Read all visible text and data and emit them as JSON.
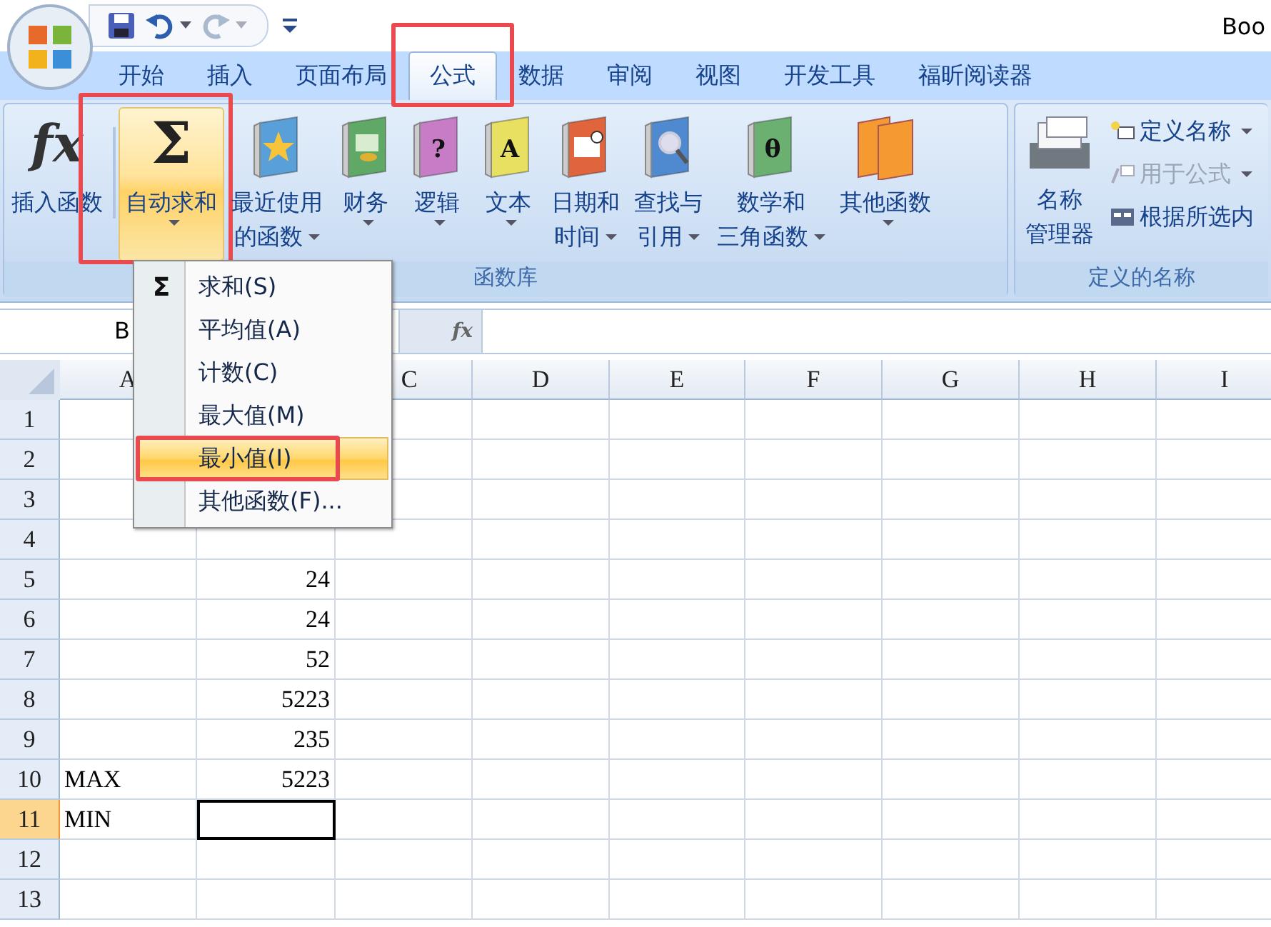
{
  "window": {
    "title": "Boo"
  },
  "tabs": [
    {
      "label": "开始",
      "selected": false,
      "annotated": false
    },
    {
      "label": "插入",
      "selected": false,
      "annotated": false
    },
    {
      "label": "页面布局",
      "selected": false,
      "annotated": false
    },
    {
      "label": "公式",
      "selected": true,
      "annotated": true
    },
    {
      "label": "数据",
      "selected": false,
      "annotated": false
    },
    {
      "label": "审阅",
      "selected": false,
      "annotated": false
    },
    {
      "label": "视图",
      "selected": false,
      "annotated": false
    },
    {
      "label": "开发工具",
      "selected": false,
      "annotated": false
    },
    {
      "label": "福昕阅读器",
      "selected": false,
      "annotated": false
    }
  ],
  "function_library": {
    "title": "函数库",
    "buttons": [
      {
        "kind": "fx",
        "glyph": "fx",
        "lines": [
          "插入函数"
        ],
        "dropdown": false,
        "pressed": false,
        "annotated": false
      },
      {
        "kind": "sigma",
        "glyph": "Σ",
        "lines": [
          "自动求和"
        ],
        "dropdown": true,
        "pressed": true,
        "annotated": true
      },
      {
        "kind": "star",
        "color": "#5aa0d8",
        "lines": [
          "最近使用",
          "的函数"
        ],
        "dropdown": true,
        "pressed": false,
        "annotated": false
      },
      {
        "kind": "coins",
        "color": "#5fa866",
        "lines": [
          "财务"
        ],
        "dropdown": true,
        "pressed": false,
        "annotated": false
      },
      {
        "kind": "glyph",
        "glyph": "?",
        "color": "#c77cc6",
        "lines": [
          "逻辑"
        ],
        "dropdown": true,
        "pressed": false,
        "annotated": false
      },
      {
        "kind": "glyph",
        "glyph": "A",
        "color": "#e8e060",
        "lines": [
          "文本"
        ],
        "dropdown": true,
        "pressed": false,
        "annotated": false
      },
      {
        "kind": "calendar",
        "color": "#e0643c",
        "lines": [
          "日期和",
          "时间"
        ],
        "dropdown": true,
        "pressed": false,
        "annotated": false
      },
      {
        "kind": "magnifier",
        "color": "#4f8ad0",
        "lines": [
          "查找与",
          "引用"
        ],
        "dropdown": true,
        "pressed": false,
        "annotated": false
      },
      {
        "kind": "glyph",
        "glyph": "θ",
        "color": "#6bb070",
        "lines": [
          "数学和",
          "三角函数"
        ],
        "dropdown": true,
        "pressed": false,
        "annotated": false
      },
      {
        "kind": "books",
        "color": "#f49a30",
        "lines": [
          "其他函数"
        ],
        "dropdown": true,
        "pressed": false,
        "annotated": false
      }
    ]
  },
  "defined_names": {
    "title": "定义的名称",
    "manager": {
      "lines": [
        "名称",
        "管理器"
      ]
    },
    "small_buttons": [
      {
        "kind": "define",
        "label": "定义名称",
        "dropdown": true,
        "disabled": false
      },
      {
        "kind": "formula",
        "label": "用于公式",
        "dropdown": true,
        "disabled": true
      },
      {
        "kind": "selection",
        "label": "根据所选内",
        "dropdown": false,
        "disabled": false
      }
    ]
  },
  "formula_bar": {
    "name_box": "B",
    "fx": "fx"
  },
  "columns": [
    {
      "label": "A"
    },
    {},
    {
      "label": "C"
    },
    {
      "label": "D"
    },
    {
      "label": "E"
    },
    {
      "label": "F"
    },
    {
      "label": "G"
    },
    {
      "label": "H"
    },
    {
      "label": "I"
    }
  ],
  "rows": [
    {
      "label": "1",
      "selected": false,
      "cells": [
        {
          "active": false
        }
      ]
    },
    {
      "label": "2",
      "selected": false,
      "cells": [
        {
          "active": false
        }
      ]
    },
    {
      "label": "3",
      "selected": false,
      "cells": [
        {
          "active": false
        }
      ]
    },
    {
      "label": "4",
      "selected": false,
      "cells": [
        {
          "active": false
        }
      ]
    },
    {
      "label": "5",
      "selected": false,
      "cells": [
        {
          "active": false
        },
        {
          "text": "24",
          "active": false
        }
      ]
    },
    {
      "label": "6",
      "selected": false,
      "cells": [
        {
          "active": false
        },
        {
          "text": "24",
          "active": false
        }
      ]
    },
    {
      "label": "7",
      "selected": false,
      "cells": [
        {
          "active": false
        },
        {
          "text": "52",
          "active": false
        }
      ]
    },
    {
      "label": "8",
      "selected": false,
      "cells": [
        {
          "active": false
        },
        {
          "text": "5223",
          "active": false
        }
      ]
    },
    {
      "label": "9",
      "selected": false,
      "cells": [
        {
          "active": false
        },
        {
          "text": "235",
          "active": false
        }
      ]
    },
    {
      "label": "10",
      "selected": false,
      "cells": [
        {
          "text": "MAX",
          "active": false
        },
        {
          "text": "5223",
          "active": false
        }
      ]
    },
    {
      "label": "11",
      "selected": true,
      "cells": [
        {
          "text": "MIN",
          "active": false
        },
        {
          "active": true
        }
      ]
    },
    {
      "label": "12",
      "selected": false,
      "cells": [
        {
          "active": false
        },
        {
          "active": false
        }
      ]
    },
    {
      "label": "13",
      "selected": false,
      "cells": [
        {
          "active": false
        },
        {
          "active": false
        }
      ]
    }
  ],
  "autosum_menu": {
    "icon_glyph": "Σ",
    "items": [
      {
        "label": "求和(S)",
        "selected": false,
        "annotated": false
      },
      {
        "label": "平均值(A)",
        "selected": false,
        "annotated": false
      },
      {
        "label": "计数(C)",
        "selected": false,
        "annotated": false
      },
      {
        "label": "最大值(M)",
        "selected": false,
        "annotated": false
      },
      {
        "label": "最小值(I)",
        "selected": true,
        "annotated": true
      },
      {
        "label": "其他函数(F)...",
        "selected": false,
        "annotated": false
      }
    ]
  }
}
